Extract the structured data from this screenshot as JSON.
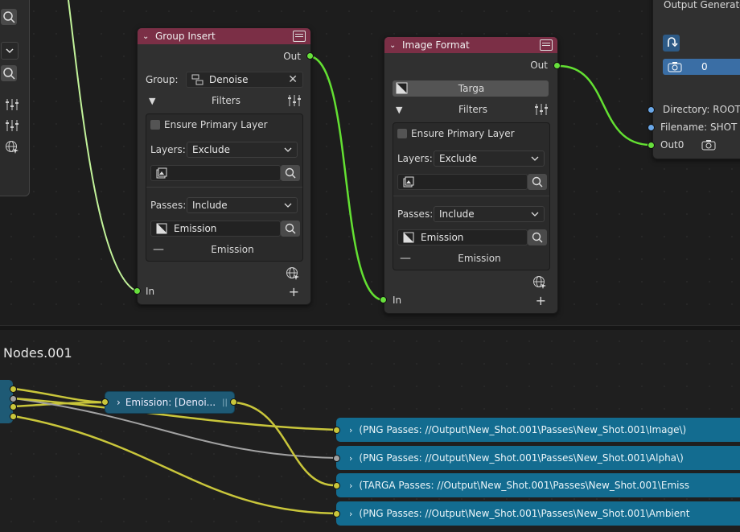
{
  "left_panel": {
    "icons": [
      "search-icon",
      "dropdown-chevron-icon",
      "search-icon",
      "sliders-icon",
      "sliders-icon",
      "globe-icon"
    ]
  },
  "group_insert": {
    "title": "Group Insert",
    "out_label": "Out",
    "group_label": "Group:",
    "group_value": "Denoise",
    "filters_label": "Filters",
    "ensure_primary_label": "Ensure Primary Layer",
    "layers_label": "Layers:",
    "layers_value": "Exclude",
    "layers_search_value": "",
    "passes_label": "Passes:",
    "passes_value": "Include",
    "passes_search_value": "Emission",
    "emission_item": "Emission",
    "in_label": "In"
  },
  "image_format": {
    "title": "Image Format",
    "out_label": "Out",
    "format_value": "Targa",
    "filters_label": "Filters",
    "ensure_primary_label": "Ensure Primary Layer",
    "layers_label": "Layers:",
    "layers_value": "Exclude",
    "layers_search_value": "",
    "passes_label": "Passes:",
    "passes_value": "Include",
    "passes_search_value": "Emission",
    "emission_item": "Emission",
    "in_label": "In"
  },
  "output_generator": {
    "title": "Output Generator",
    "counter_value": "0",
    "directory_label": "Directory: ROOT/",
    "filename_label": "Filename: SHOT",
    "out0_label": "Out0"
  },
  "bottom": {
    "title": "Nodes.001",
    "reroute_label": "Emission: [Denoi...",
    "outputs": [
      "(PNG Passes: //Output\\New_Shot.001\\Passes\\New_Shot.001\\Image\\)",
      "(PNG Passes: //Output\\New_Shot.001\\Passes\\New_Shot.001\\Alpha\\)",
      "(TARGA Passes: //Output\\New_Shot.001\\Passes\\New_Shot.001\\Emiss",
      "(PNG Passes: //Output\\New_Shot.001\\Passes\\New_Shot.001\\Ambient"
    ]
  },
  "colors": {
    "node_header": "#7b2f46",
    "wire_green": "#63e032",
    "wire_yellow": "#c9c63b",
    "output_bar": "#136c90",
    "socket_blue": "#6aa7e8"
  }
}
